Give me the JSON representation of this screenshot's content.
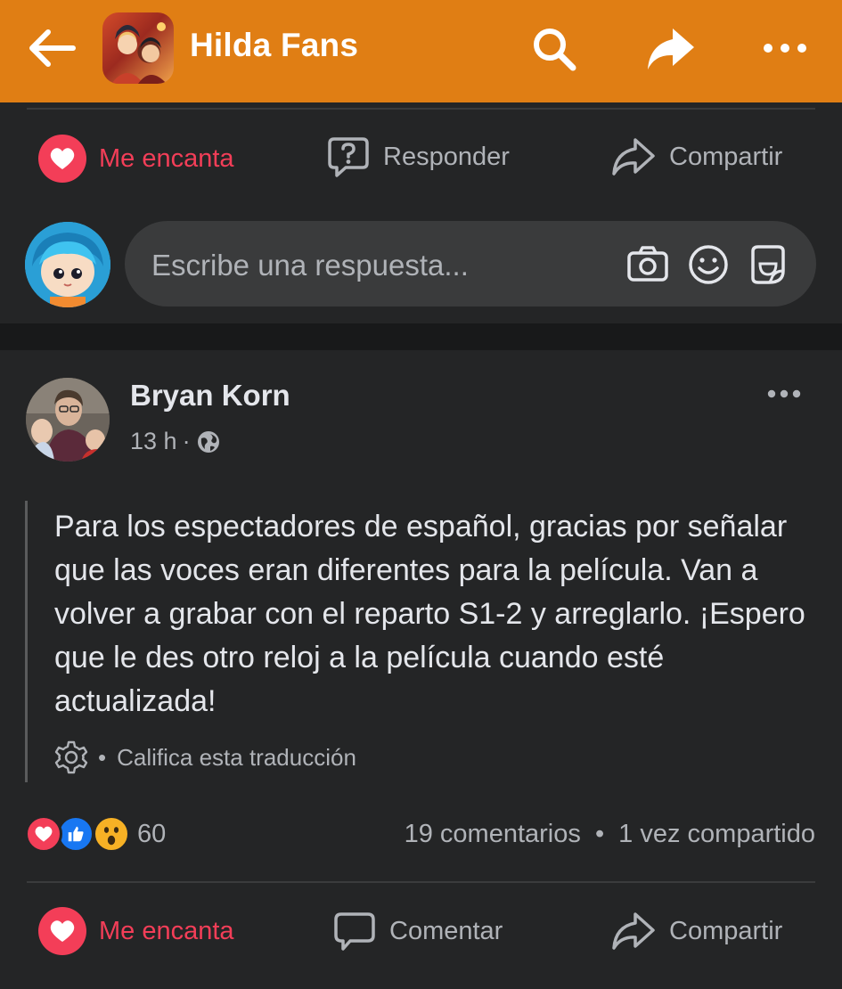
{
  "header": {
    "title": "Hilda Fans",
    "background_color": "#e07e14",
    "icons": [
      "back-arrow-icon",
      "search-icon",
      "share-icon",
      "more-icon"
    ]
  },
  "top_actions": {
    "love": "Me encanta",
    "reply": "Responder",
    "share": "Compartir"
  },
  "composer": {
    "placeholder": "Escribe una respuesta...",
    "icons": [
      "camera-icon",
      "emoji-icon",
      "sticker-icon"
    ]
  },
  "post": {
    "author": "Bryan Korn",
    "time": "13 h",
    "separator": "·",
    "audience_icon": "globe-icon",
    "text": "Para los espectadores de español, gracias por señalar que las voces eran diferentes para la película. Van a volver a grabar con el reparto S1-2 y arreglarlo. ¡Espero que le des otro reloj a la película cuando esté actualizada!",
    "rate_translation": "Califica esta traducción",
    "reaction_count": "60",
    "comments": "19 comentarios",
    "shares": "1 vez compartido",
    "dot": "•"
  },
  "bottom_actions": {
    "love": "Me encanta",
    "comment": "Comentar",
    "share": "Compartir"
  },
  "colors": {
    "love": "#f33e58",
    "like": "#1877f2",
    "wow": "#f7b125",
    "background": "#242526",
    "muted_text": "#b0b3b8"
  }
}
